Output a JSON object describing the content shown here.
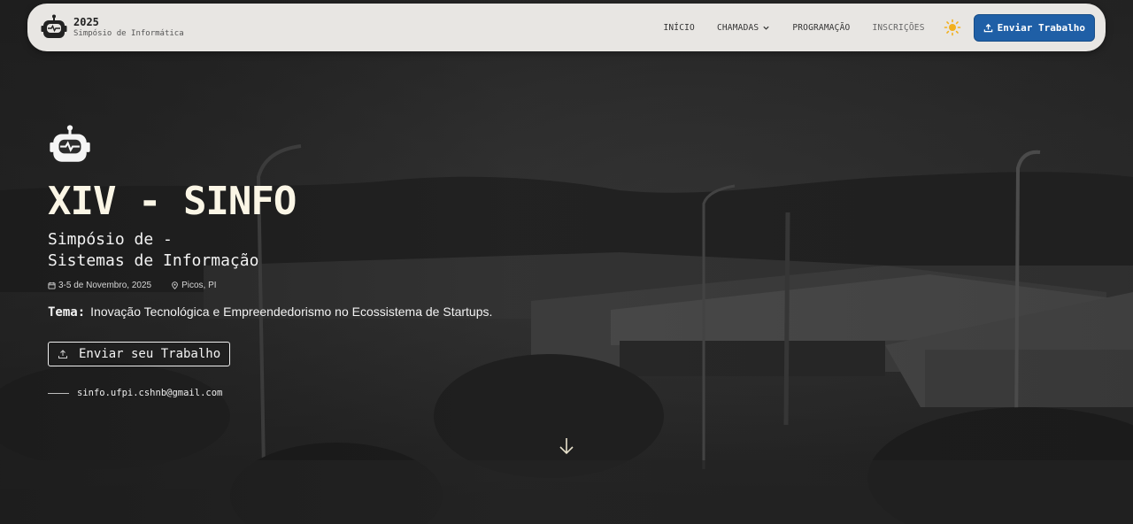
{
  "navbar": {
    "logo_icon": "robot-icon",
    "brand_year": "2025",
    "brand_subtitle": "Simpósio de Informática",
    "links": [
      {
        "label": "INÍCIO"
      },
      {
        "label": "CHAMADAS",
        "has_dropdown": true
      },
      {
        "label": "PROGRAMAÇÃO"
      },
      {
        "label": "INSCRIÇÕES"
      }
    ],
    "theme_icon": "sun-icon",
    "submit_button": {
      "icon": "upload-icon",
      "label": "Enviar Trabalho",
      "color": "#1f5fa6"
    }
  },
  "hero": {
    "logo_icon": "robot-icon",
    "title": "XIV - SINFO",
    "subtitle_line1": "Simpósio de -",
    "subtitle_line2": "Sistemas de Informação",
    "date": "3-5 de Novembro, 2025",
    "location": "Picos, PI",
    "theme_label": "Tema:",
    "theme_text": "Inovação Tecnológica e Empreendedorismo no Ecossistema de Startups.",
    "cta_label": "Enviar seu Trabalho",
    "email": "sinfo.ufpi.cshnb@gmail.com"
  },
  "scroll_icon": "arrow-down-icon",
  "colors": {
    "title": "#fbf6e6",
    "navbar_bg": "#e8e6e3",
    "accent": "#1f5fa6"
  }
}
